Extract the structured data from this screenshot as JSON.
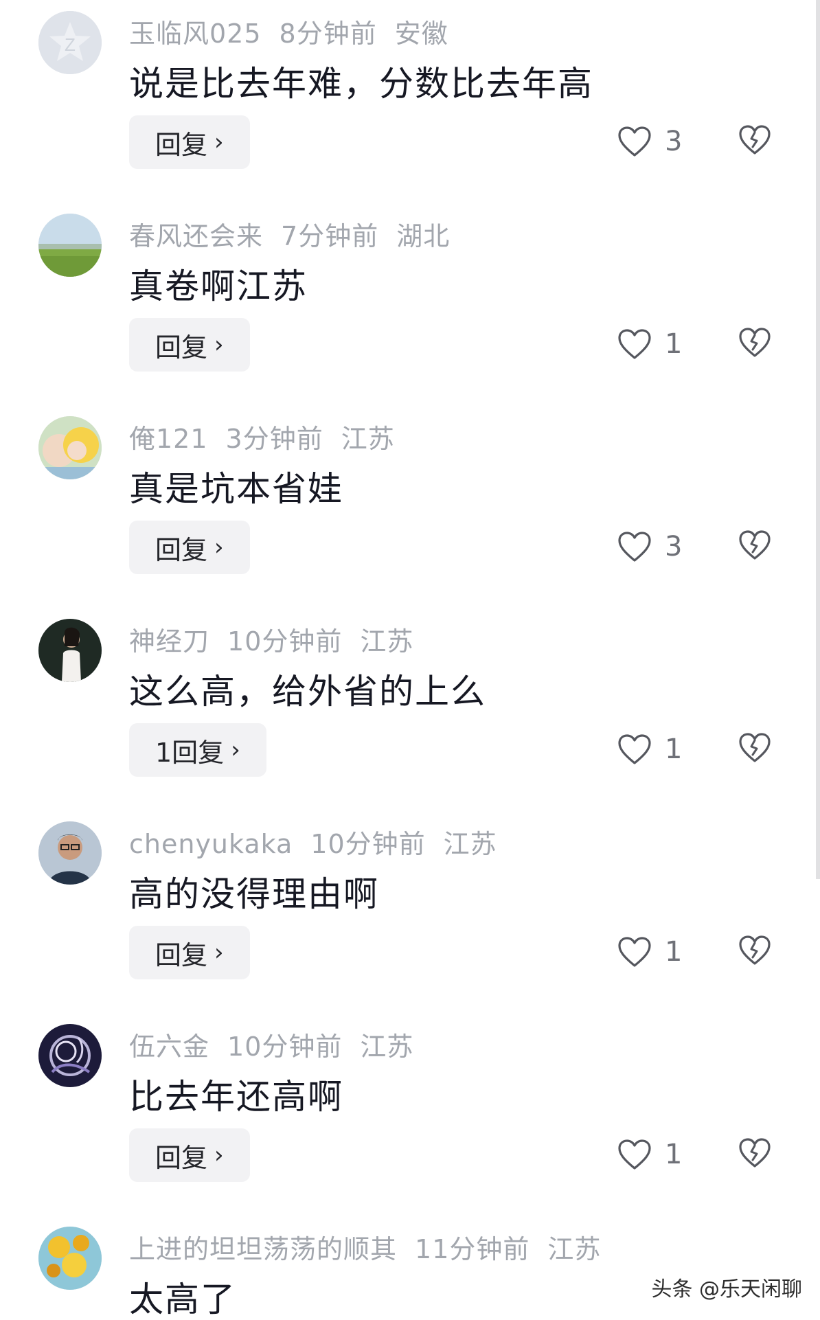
{
  "reply_chevron": "›",
  "comments": [
    {
      "username": "玉临风025",
      "time": "8分钟前",
      "location": "安徽",
      "text": "说是比去年难，分数比去年高",
      "reply_label": "回复",
      "likes": "3",
      "avatar_icon": "default-star-avatar-icon"
    },
    {
      "username": "春风还会来",
      "time": "7分钟前",
      "location": "湖北",
      "text": "真卷啊江苏",
      "reply_label": "回复",
      "likes": "1",
      "avatar_icon": "landscape-avatar-icon"
    },
    {
      "username": "俺121",
      "time": "3分钟前",
      "location": "江苏",
      "text": "真是坑本省娃",
      "reply_label": "回复",
      "likes": "3",
      "avatar_icon": "cartoon-avatar-icon"
    },
    {
      "username": "神经刀",
      "time": "10分钟前",
      "location": "江苏",
      "text": "这么高，给外省的上么",
      "reply_label": "1回复",
      "likes": "1",
      "avatar_icon": "person-photo-avatar-icon"
    },
    {
      "username": "chenyukaka",
      "time": "10分钟前",
      "location": "江苏",
      "text": "高的没得理由啊",
      "reply_label": "回复",
      "likes": "1",
      "avatar_icon": "man-with-glasses-avatar-icon"
    },
    {
      "username": "伍六金",
      "time": "10分钟前",
      "location": "江苏",
      "text": "比去年还高啊",
      "reply_label": "回复",
      "likes": "1",
      "avatar_icon": "abstract-art-avatar-icon"
    },
    {
      "username": "上进的坦坦荡荡的顺其",
      "time": "11分钟前",
      "location": "江苏",
      "text": "太高了",
      "avatar_icon": "yellow-flower-avatar-icon"
    }
  ],
  "watermark": "头条 @乐天闲聊",
  "colors": {
    "meta_text": "#a2a6ad",
    "body_text": "#161823",
    "reply_bg": "#f2f2f4",
    "icon_stroke": "#55575e"
  }
}
